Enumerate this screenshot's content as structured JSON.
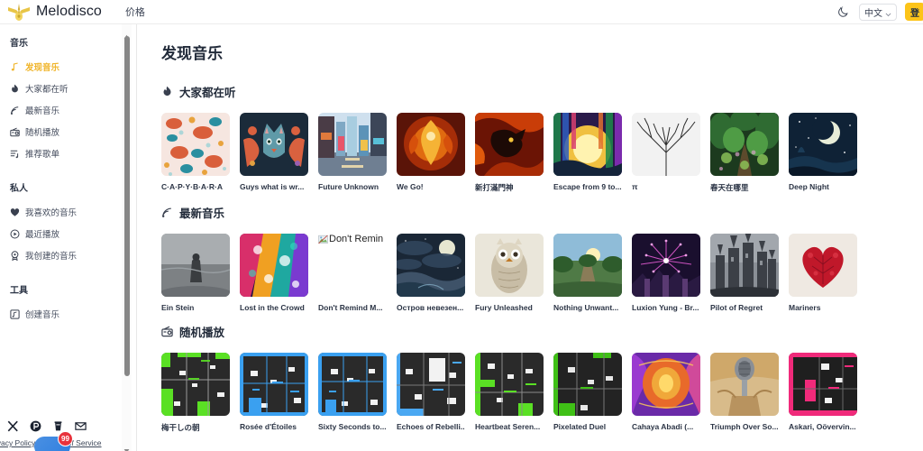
{
  "topbar": {
    "brand_name": "Melodisco",
    "logo_icon": "winged-guitar-logo",
    "nav_pricing": "价格",
    "theme_toggle_icon": "moon-icon",
    "language_value": "中文",
    "language_chevron_icon": "chevron-down-icon",
    "cta_label": "登",
    "accent_color": "#fcc419"
  },
  "sidebar": {
    "groups": [
      {
        "title": "音乐",
        "items": [
          {
            "label": "发现音乐",
            "icon": "music-note-icon",
            "active": true
          },
          {
            "label": "大家都在听",
            "icon": "flame-icon",
            "active": false
          },
          {
            "label": "最新音乐",
            "icon": "rss-wave-icon",
            "active": false
          },
          {
            "label": "随机播放",
            "icon": "radio-icon",
            "active": false
          },
          {
            "label": "推荐歌单",
            "icon": "playlist-icon",
            "active": false
          }
        ]
      },
      {
        "title": "私人",
        "items": [
          {
            "label": "我喜欢的音乐",
            "icon": "heart-icon",
            "active": false
          },
          {
            "label": "最近播放",
            "icon": "clock-play-icon",
            "active": false
          },
          {
            "label": "我创建的音乐",
            "icon": "badge-icon",
            "active": false
          }
        ]
      },
      {
        "title": "工具",
        "items": [
          {
            "label": "创建音乐",
            "icon": "create-music-icon",
            "active": false
          }
        ]
      }
    ],
    "scrollbar": {
      "up_arrow_icon": "scroll-up-arrow-icon",
      "down_arrow_icon": "scroll-down-arrow-icon"
    },
    "footer": {
      "socials": [
        {
          "name": "x-twitter-icon",
          "label": "X"
        },
        {
          "name": "product-hunt-icon",
          "label": "P"
        },
        {
          "name": "coffee-cup-icon",
          "label": "Coffee"
        },
        {
          "name": "email-icon",
          "label": "Email"
        }
      ],
      "privacy_policy": "rivacy Policy",
      "terms_of_service": "Terms of Service",
      "chat_badge_count": "99"
    }
  },
  "main": {
    "page_title": "发现音乐",
    "sections": [
      {
        "icon": "flame-icon",
        "title": "大家都在听",
        "cards": [
          {
            "title": "C·A·P·Y·B·A·R·A",
            "art": "capybara-pattern",
            "broken": false
          },
          {
            "title": "Guys what is wr...",
            "art": "cat-portrait",
            "broken": false
          },
          {
            "title": "Future Unknown",
            "art": "neon-city",
            "broken": false
          },
          {
            "title": "We Go!",
            "art": "phoenix-fire",
            "broken": false
          },
          {
            "title": "新打滿門神",
            "art": "dragon-fire",
            "broken": false
          },
          {
            "title": "Escape from 9 to...",
            "art": "rainbow-forest",
            "broken": false
          },
          {
            "title": "π",
            "art": "fractal-tree",
            "broken": false
          },
          {
            "title": "春天在哪里",
            "art": "green-forest",
            "broken": false
          },
          {
            "title": "Deep Night",
            "art": "moon-night",
            "broken": false
          }
        ]
      },
      {
        "icon": "rss-wave-icon",
        "title": "最新音乐",
        "cards": [
          {
            "title": "Ein Stein",
            "art": "grey-beach",
            "broken": false
          },
          {
            "title": "Lost in the Crowd",
            "art": "colorful-abstract",
            "broken": false
          },
          {
            "title": "Don't Remind M...",
            "art": "broken-image",
            "broken": true,
            "alt": "Don't Remin"
          },
          {
            "title": "Остров невезен...",
            "art": "moon-clouds",
            "broken": false
          },
          {
            "title": "Fury Unleashed",
            "art": "owl-illustration",
            "broken": false
          },
          {
            "title": "Nothing Unwant...",
            "art": "sunset-road",
            "broken": false
          },
          {
            "title": "Luxion Yung - Br...",
            "art": "fireworks-castle",
            "broken": false
          },
          {
            "title": "Pilot of Regret",
            "art": "dark-castle",
            "broken": false
          },
          {
            "title": "Mariners",
            "art": "red-heart-tree",
            "broken": false
          }
        ]
      },
      {
        "icon": "radio-icon",
        "title": "随机播放",
        "cards": [
          {
            "title": "梅干しの朝",
            "art": "pixel-green",
            "broken": false
          },
          {
            "title": "Rosée d'Étoiles",
            "art": "pixel-blue",
            "broken": false
          },
          {
            "title": "Sixty Seconds to...",
            "art": "pixel-blue",
            "broken": false
          },
          {
            "title": "Echoes of Rebelli...",
            "art": "pixel-blue-light",
            "broken": false
          },
          {
            "title": "Heartbeat Seren...",
            "art": "pixel-green",
            "broken": false
          },
          {
            "title": "Pixelated Duel",
            "art": "pixel-green-dark",
            "broken": false
          },
          {
            "title": "Cahaya Abadi (...",
            "art": "orange-abstract",
            "broken": false
          },
          {
            "title": "Triumph Over So...",
            "art": "microphone-art",
            "broken": false
          },
          {
            "title": "Askari, Oövervin...",
            "art": "pixel-pink",
            "broken": false
          }
        ]
      }
    ]
  }
}
